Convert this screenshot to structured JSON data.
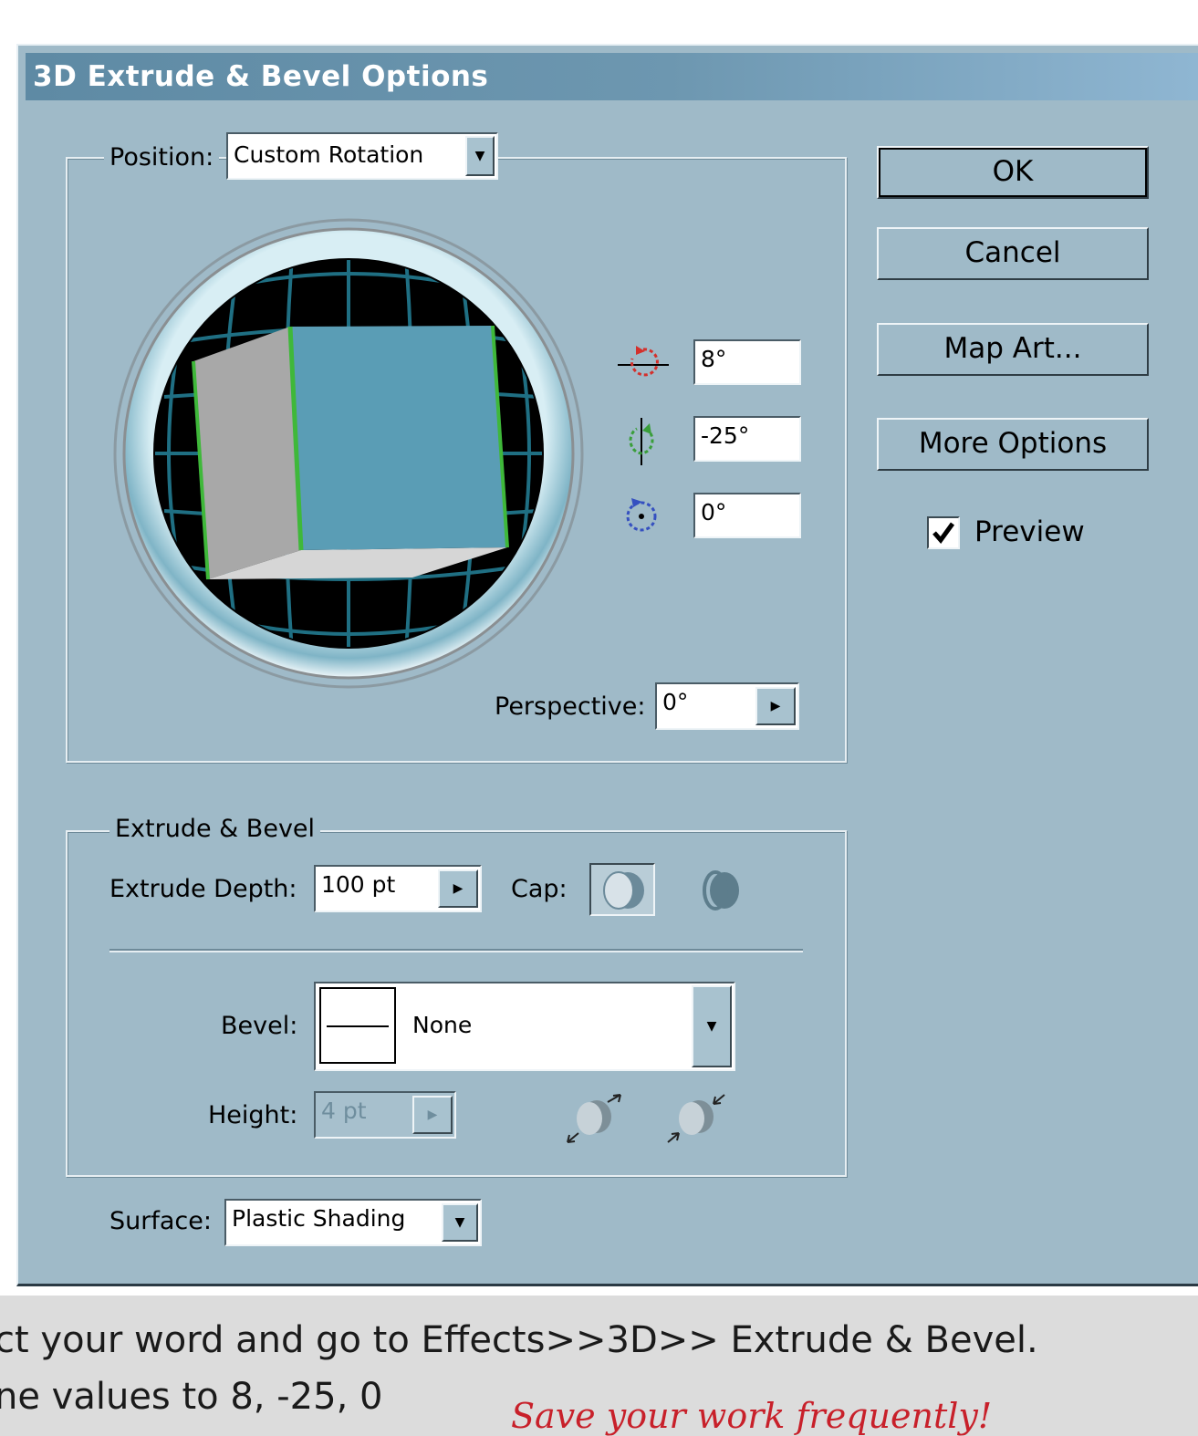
{
  "dialog": {
    "title": "3D Extrude & Bevel Options"
  },
  "position": {
    "label": "Position:",
    "value": "Custom Rotation",
    "rotation_x": "8°",
    "rotation_y": "-25°",
    "rotation_z": "0°",
    "perspective_label": "Perspective:",
    "perspective_value": "0°"
  },
  "extrude": {
    "legend": "Extrude & Bevel",
    "depth_label": "Extrude Depth:",
    "depth_value": "100 pt",
    "cap_label": "Cap:",
    "bevel_label": "Bevel:",
    "bevel_value": "None",
    "height_label": "Height:",
    "height_value": "4 pt"
  },
  "surface": {
    "label": "Surface:",
    "value": "Plastic Shading"
  },
  "buttons": {
    "ok": "OK",
    "cancel": "Cancel",
    "map_art": "Map Art...",
    "more_options": "More Options"
  },
  "preview": {
    "label": "Preview",
    "checked": true
  },
  "caption": {
    "line1": "ct your word and go to Effects>>3D>> Extrude & Bevel.",
    "line2": "ne values to 8, -25, 0",
    "note": "Save your work frequently!"
  },
  "colors": {
    "dialog_bg": "#9fbac8",
    "cube_front": "#5a9db5",
    "cube_side": "#a9a9a9",
    "edge_green": "#3fb83a"
  }
}
